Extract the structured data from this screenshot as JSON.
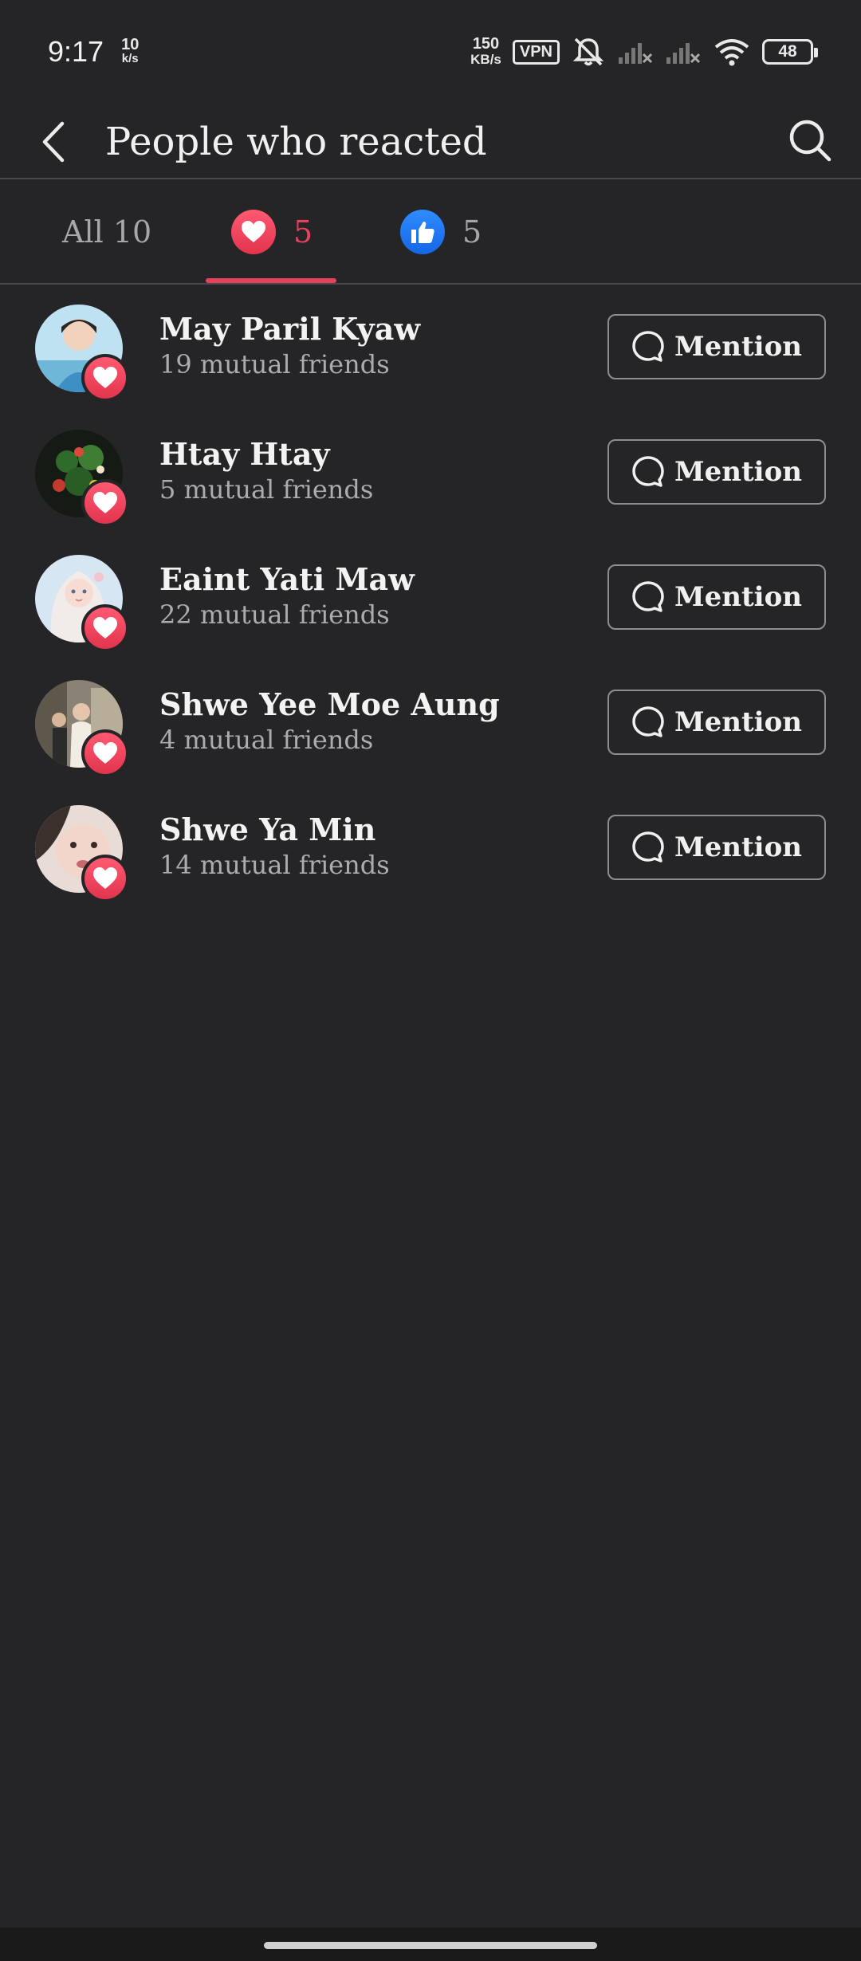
{
  "status_bar": {
    "time": "9:17",
    "net_speed_left_value": "10",
    "net_speed_left_unit": "k/s",
    "net_speed_right_value": "150",
    "net_speed_right_unit": "KB/s",
    "vpn": "VPN",
    "battery": "48",
    "icons": [
      "mute-bell-icon",
      "signal-icon",
      "signal-icon",
      "wifi-icon",
      "battery-icon"
    ]
  },
  "header": {
    "title": "People who reacted",
    "back_icon": "back-arrow-icon",
    "search_icon": "search-icon"
  },
  "tabs": [
    {
      "label": "All 10",
      "active": false
    },
    {
      "icon": "love-reaction-icon",
      "count": "5",
      "active": true
    },
    {
      "icon": "like-reaction-icon",
      "count": "5",
      "active": false
    }
  ],
  "people": [
    {
      "name": "May Paril Kyaw",
      "mutual": "19 mutual friends",
      "reaction": "love",
      "button": "Mention"
    },
    {
      "name": "Htay Htay",
      "mutual": "5 mutual friends",
      "reaction": "love",
      "button": "Mention"
    },
    {
      "name": "Eaint Yati Maw",
      "mutual": "22 mutual friends",
      "reaction": "love",
      "button": "Mention"
    },
    {
      "name": "Shwe Yee Moe Aung",
      "mutual": "4 mutual friends",
      "reaction": "love",
      "button": "Mention"
    },
    {
      "name": "Shwe Ya Min",
      "mutual": "14 mutual friends",
      "reaction": "love",
      "button": "Mention"
    }
  ],
  "colors": {
    "background": "#252527",
    "accent": "#e8415b",
    "like_blue": "#1877f2"
  }
}
